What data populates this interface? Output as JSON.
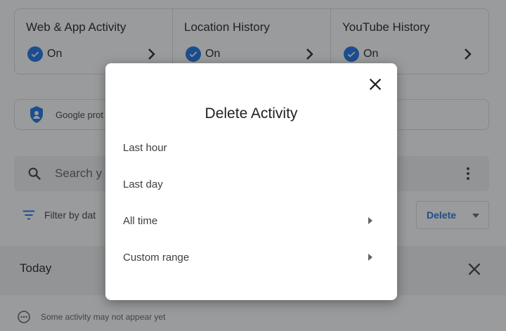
{
  "activity_controls": [
    {
      "title": "Web & App Activity",
      "status": "On"
    },
    {
      "title": "Location History",
      "status": "On"
    },
    {
      "title": "YouTube History",
      "status": "On"
    }
  ],
  "protect": {
    "text": "Google prot"
  },
  "search": {
    "placeholder": "Search y"
  },
  "filter": {
    "label": "Filter by dat"
  },
  "delete_button": {
    "label": "Delete"
  },
  "today": {
    "label": "Today"
  },
  "notice": {
    "text": "Some activity may not appear yet"
  },
  "dialog": {
    "title": "Delete Activity",
    "options": [
      {
        "label": "Last hour"
      },
      {
        "label": "Last day"
      },
      {
        "label": "All time"
      },
      {
        "label": "Custom range"
      }
    ]
  },
  "colors": {
    "accent": "#1a73e8",
    "scrim": "rgba(32,33,36,0.45)"
  }
}
